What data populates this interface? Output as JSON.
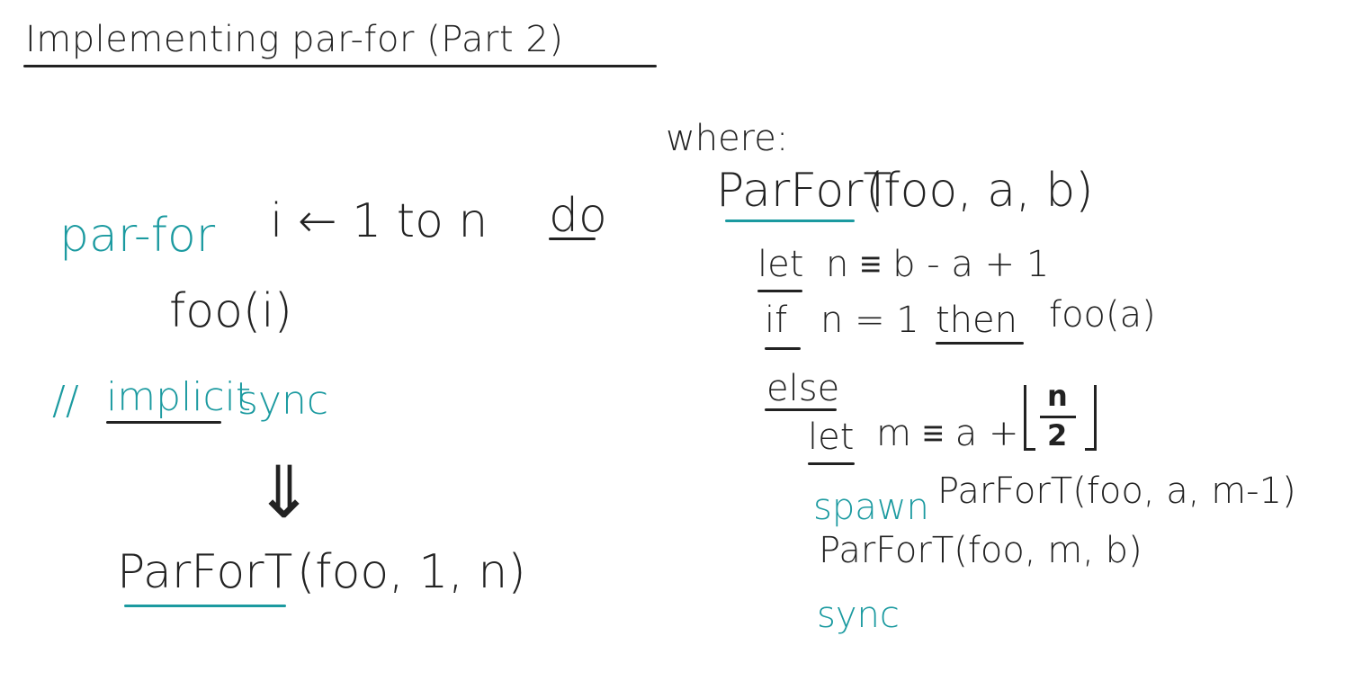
{
  "title": "Implementing par-for (Part 2)",
  "left": {
    "parfor_keyword": "par-for",
    "loop_rest": "i ← 1 to n",
    "do_keyword": "do",
    "body": "foo(i)",
    "comment_prefix": "//",
    "comment_implicit": "implicit",
    "comment_sync": "sync",
    "arrow": "⇓",
    "call_name": "ParForT",
    "call_args": "(foo, 1, n)"
  },
  "right": {
    "where": "where:",
    "def_name": "ParForT",
    "def_args": "(foo, a, b)",
    "let1_kw": "let",
    "let1_rest": "n ≡ b - a + 1",
    "if_kw": "if",
    "if_cond": "n = 1",
    "then_kw": "then",
    "if_body": "foo(a)",
    "else_kw": "else",
    "let2_kw": "let",
    "let2_rest": "m ≡ a +",
    "frac_num": "n",
    "frac_den": "2",
    "spawn_kw": "spawn",
    "spawn_call": "ParForT(foo, a, m-1)",
    "call2": "ParForT(foo, m, b)",
    "sync_kw": "sync"
  },
  "colors": {
    "ink": "#222222",
    "teal": "#1b9aa0"
  }
}
